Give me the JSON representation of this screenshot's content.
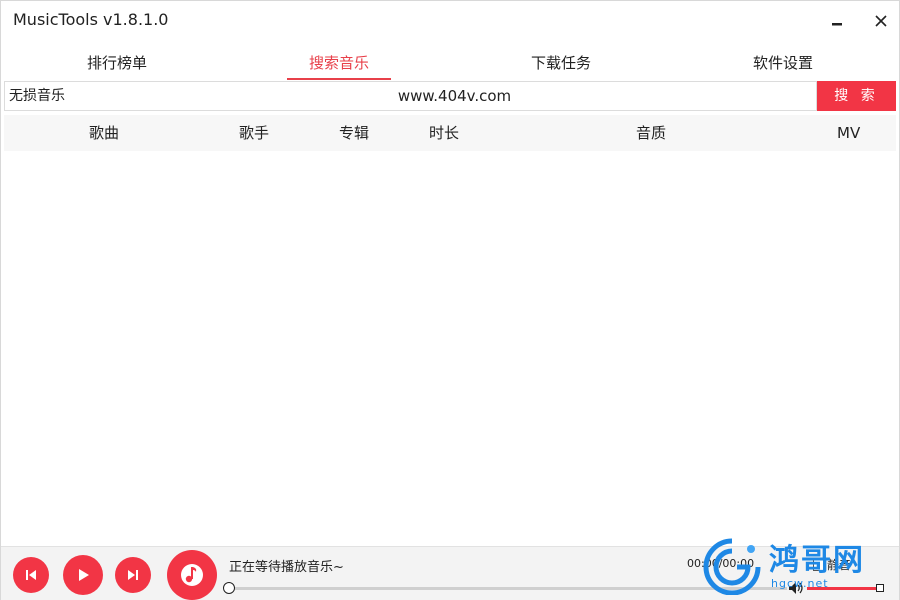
{
  "window": {
    "title": "MusicTools v1.8.1.0",
    "minimize_icon": "minimize-icon",
    "close_icon": "close-icon"
  },
  "tabs": [
    {
      "label": "排行榜单",
      "active": false
    },
    {
      "label": "搜索音乐",
      "active": true
    },
    {
      "label": "下载任务",
      "active": false
    },
    {
      "label": "软件设置",
      "active": false
    }
  ],
  "search": {
    "source": "无损音乐",
    "query": "www.404v.com",
    "button_label": "搜 索"
  },
  "table": {
    "columns": [
      "歌曲",
      "歌手",
      "专辑",
      "时长",
      "音质",
      "MV"
    ],
    "rows": []
  },
  "player": {
    "status_text": "正在等待播放音乐~",
    "time_text": "00:00/00:00",
    "mute_label": "静音",
    "progress": 0,
    "volume": 1.0,
    "icons": [
      "prev-icon",
      "play-icon",
      "next-icon",
      "music-note-icon",
      "volume-icon"
    ]
  },
  "watermark": {
    "title": "鸿哥网",
    "subtitle": "hgcw.net"
  },
  "colors": {
    "accent": "#f23545",
    "tab_active": "#e8404a",
    "watermark": "#1e88e5"
  }
}
